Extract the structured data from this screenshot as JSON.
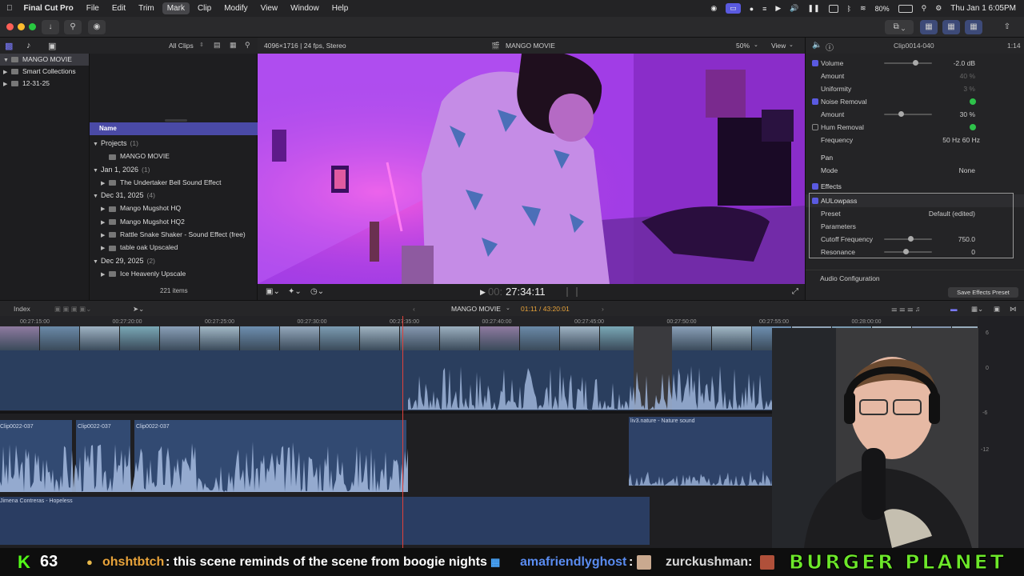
{
  "menubar": {
    "app": "Final Cut Pro",
    "items": [
      "File",
      "Edit",
      "Trim",
      "Mark",
      "Clip",
      "Modify",
      "View",
      "Window",
      "Help"
    ],
    "battery": "80%",
    "datetime": "Thu Jan 1  6:05PM"
  },
  "library": {
    "items": [
      {
        "label": "MANGO MOVIE"
      },
      {
        "label": "Smart Collections"
      },
      {
        "label": "12-31-25"
      }
    ]
  },
  "browser": {
    "filter": "All Clips",
    "column": "Name",
    "count": "221 items",
    "rows": [
      {
        "type": "group",
        "label": "Projects",
        "count": "(1)"
      },
      {
        "type": "item",
        "label": "MANGO MOVIE"
      },
      {
        "type": "group",
        "label": "Jan 1, 2026",
        "count": "(1)"
      },
      {
        "type": "item",
        "label": "The Undertaker Bell  Sound Effect"
      },
      {
        "type": "group",
        "label": "Dec 31, 2025",
        "count": "(4)"
      },
      {
        "type": "item",
        "label": "Mango Mugshot HQ"
      },
      {
        "type": "item",
        "label": "Mango Mugshot HQ2"
      },
      {
        "type": "item",
        "label": "Rattle Snake Shaker - Sound Effect (free)"
      },
      {
        "type": "item",
        "label": "table oak Upscaled"
      },
      {
        "type": "group",
        "label": "Dec 29, 2025",
        "count": "(2)"
      },
      {
        "type": "item",
        "label": "Ice Heavenly Upscale"
      }
    ]
  },
  "viewer": {
    "format": "4096×1716 | 24 fps, Stereo",
    "title": "MANGO MOVIE",
    "zoom": "50%",
    "view": "View",
    "timecode": "27:34:11",
    "timecode_prefix": "00:"
  },
  "inspector": {
    "clip": "Clip0014-040",
    "duration": "1:14",
    "rows": [
      {
        "label": "Volume",
        "value": "-2.0  dB",
        "check": "on",
        "slider": 0.6
      },
      {
        "label": "Amount",
        "value": "40  %",
        "dim": true
      },
      {
        "label": "Uniformity",
        "value": "3  %",
        "dim": true
      },
      {
        "label": "Noise Removal",
        "check": "on",
        "green": true
      },
      {
        "label": "Amount",
        "value": "30  %",
        "slider": 0.3
      },
      {
        "label": "Hum Removal",
        "check": "off",
        "green": true
      },
      {
        "label": "Frequency",
        "value": "50 Hz     60 Hz"
      },
      {
        "label": "Pan",
        "section": true
      },
      {
        "label": "Mode",
        "value": "None"
      },
      {
        "label": "Effects",
        "check": "on",
        "section": true
      },
      {
        "label": "AULowpass",
        "check": "on",
        "boxed": true
      },
      {
        "label": "Preset",
        "value": "Default (edited)"
      },
      {
        "label": "Parameters"
      },
      {
        "label": "Cutoff Frequency",
        "value": "750.0",
        "slider": 0.5
      },
      {
        "label": "Resonance",
        "value": "0",
        "slider": 0.4
      }
    ],
    "audio_config": "Audio Configuration",
    "save_preset": "Save Effects Preset"
  },
  "timeline": {
    "index": "Index",
    "project": "MANGO MOVIE",
    "position": "01:11 / 43:20:01",
    "ruler": [
      "00:27:15:00",
      "00:27:20:00",
      "00:27:25:00",
      "00:27:30:00",
      "00:27:35:00",
      "00:27:40:00",
      "00:27:45:00",
      "00:27:50:00",
      "00:27:55:00",
      "00:28:00:00"
    ],
    "clips": [
      "Clip0022-037",
      "Clip0022-037",
      "Clip0022-037"
    ],
    "audio_a": "liv3.nature - Nature sound",
    "audio_b": "Jimena Contreras - Hopeless",
    "meter": [
      "6",
      "0",
      "-6",
      "-12"
    ]
  },
  "stream": {
    "k_count": "63",
    "user": "ohshtbtch",
    "msg": ": this scene reminds of the scene from boogie nights",
    "user2": "amafriendlyghost",
    "sep2": ":",
    "user3": "zurckushman",
    "sep3": ":",
    "banner": "BURGER PLANET"
  },
  "colors": {
    "accent": "#5a5ae0",
    "purple": "#b43cff",
    "kick": "#53fc18",
    "banner": "#6de82a"
  }
}
